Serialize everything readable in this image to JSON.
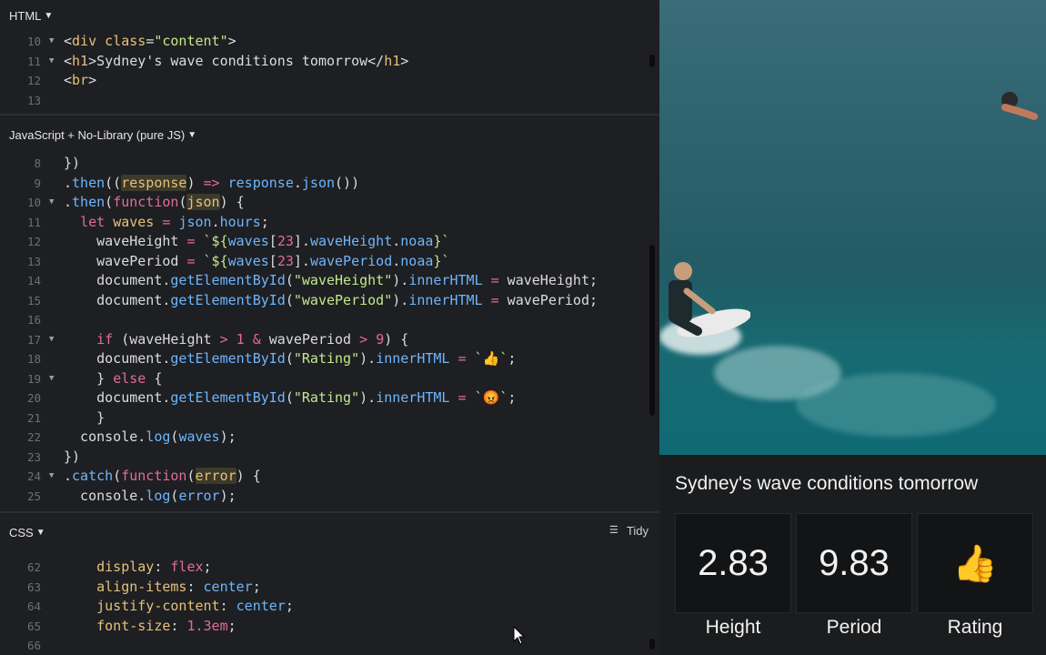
{
  "html_panel": {
    "header": "HTML",
    "lines": [
      {
        "n": "10",
        "fold": true,
        "html": "&lt;<span class=\"t-tag\">div</span> <span class=\"t-attr\">class</span>=<span class=\"t-str\">\"content\"</span>&gt;"
      },
      {
        "n": "11",
        "fold": true,
        "html": "&lt;<span class=\"t-tag\">h1</span>&gt;Sydney's wave conditions tomorrow&lt;/<span class=\"t-tag\">h1</span>&gt;"
      },
      {
        "n": "12",
        "fold": false,
        "html": "&lt;<span class=\"t-tag\">br</span>&gt;"
      },
      {
        "n": "13",
        "fold": false,
        "html": ""
      }
    ]
  },
  "js_panel": {
    "header": "JavaScript + No-Library (pure JS)",
    "lines": [
      {
        "n": "8",
        "fold": false,
        "html": "})"
      },
      {
        "n": "9",
        "fold": false,
        "html": ".<span class=\"t-var\">then</span>((<span class=\"hl\">response</span>) <span class=\"t-op\">=&gt;</span> <span class=\"t-var\">response</span>.<span class=\"t-var\">json</span>())"
      },
      {
        "n": "10",
        "fold": true,
        "html": ".<span class=\"t-var\">then</span>(<span class=\"t-fn\">function</span>(<span class=\"hl\">json</span>) {"
      },
      {
        "n": "11",
        "fold": false,
        "html": "  <span class=\"t-kw\">let</span> <span class=\"t-prop\">waves</span> <span class=\"t-op\">=</span> <span class=\"t-var\">json</span>.<span class=\"t-var\">hours</span>;"
      },
      {
        "n": "12",
        "fold": false,
        "html": "    waveHeight <span class=\"t-op\">=</span> <span class=\"t-str\">`${</span><span class=\"t-var\">waves</span>[<span class=\"t-num\">23</span>].<span class=\"t-var\">waveHeight</span>.<span class=\"t-var\">noaa</span><span class=\"t-str\">}`</span>"
      },
      {
        "n": "13",
        "fold": false,
        "html": "    wavePeriod <span class=\"t-op\">=</span> <span class=\"t-str\">`${</span><span class=\"t-var\">waves</span>[<span class=\"t-num\">23</span>].<span class=\"t-var\">wavePeriod</span>.<span class=\"t-var\">noaa</span><span class=\"t-str\">}`</span>"
      },
      {
        "n": "14",
        "fold": false,
        "html": "    document.<span class=\"t-var\">getElementById</span>(<span class=\"t-str\">\"waveHeight\"</span>).<span class=\"t-var\">innerHTML</span> <span class=\"t-op\">=</span> waveHeight;"
      },
      {
        "n": "15",
        "fold": false,
        "html": "    document.<span class=\"t-var\">getElementById</span>(<span class=\"t-str\">\"wavePeriod\"</span>).<span class=\"t-var\">innerHTML</span> <span class=\"t-op\">=</span> wavePeriod;"
      },
      {
        "n": "16",
        "fold": false,
        "html": ""
      },
      {
        "n": "17",
        "fold": true,
        "html": "    <span class=\"t-kw\">if</span> (waveHeight <span class=\"t-op\">&gt;</span> <span class=\"t-num\">1</span> <span class=\"t-op\">&amp;</span> wavePeriod <span class=\"t-op\">&gt;</span> <span class=\"t-num\">9</span>) {"
      },
      {
        "n": "18",
        "fold": false,
        "html": "    document.<span class=\"t-var\">getElementById</span>(<span class=\"t-str\">\"Rating\"</span>).<span class=\"t-var\">innerHTML</span> <span class=\"t-op\">=</span> <span class=\"t-str\">`👍`</span>;"
      },
      {
        "n": "19",
        "fold": true,
        "html": "    } <span class=\"t-kw\">else</span> {"
      },
      {
        "n": "20",
        "fold": false,
        "html": "    document.<span class=\"t-var\">getElementById</span>(<span class=\"t-str\">\"Rating\"</span>).<span class=\"t-var\">innerHTML</span> <span class=\"t-op\">=</span> <span class=\"t-str\">`😡`</span>;"
      },
      {
        "n": "21",
        "fold": false,
        "html": "    }"
      },
      {
        "n": "22",
        "fold": false,
        "html": "  console.<span class=\"t-var\">log</span>(<span class=\"t-var\">waves</span>);"
      },
      {
        "n": "23",
        "fold": false,
        "html": "})"
      },
      {
        "n": "24",
        "fold": true,
        "html": ".<span class=\"t-var\">catch</span>(<span class=\"t-fn\">function</span>(<span class=\"hl\">error</span>) {"
      },
      {
        "n": "25",
        "fold": false,
        "html": "  console.<span class=\"t-var\">log</span>(<span class=\"t-var\">error</span>);"
      }
    ]
  },
  "css_panel": {
    "header": "CSS",
    "tidy": "Tidy",
    "lines": [
      {
        "n": "62",
        "fold": false,
        "html": "    <span class=\"t-prop\">display</span>: <span class=\"t-val\">flex</span>;"
      },
      {
        "n": "63",
        "fold": false,
        "html": "    <span class=\"t-prop\">align-items</span>: <span class=\"t-var\">center</span>;"
      },
      {
        "n": "64",
        "fold": false,
        "html": "    <span class=\"t-prop\">justify-content</span>: <span class=\"t-var\">center</span>;"
      },
      {
        "n": "65",
        "fold": false,
        "html": "    <span class=\"t-prop\">font-size</span>: <span class=\"t-num\">1.3em</span>;"
      },
      {
        "n": "66",
        "fold": false,
        "html": ""
      }
    ]
  },
  "preview": {
    "title": "Sydney's wave conditions tomorrow",
    "cards": [
      {
        "value": "2.83",
        "label": "Height"
      },
      {
        "value": "9.83",
        "label": "Period"
      },
      {
        "value": "👍",
        "label": "Rating"
      }
    ]
  }
}
